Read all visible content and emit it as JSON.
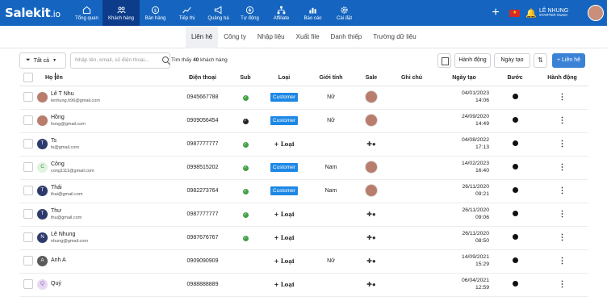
{
  "brand": {
    "logo_main": "Salekit",
    "logo_suffix": ".io"
  },
  "nav": [
    {
      "label": "Tổng quan",
      "icon": "home-icon"
    },
    {
      "label": "Khách hàng",
      "icon": "users-icon",
      "active": true
    },
    {
      "label": "Bán hàng",
      "icon": "dollar-icon"
    },
    {
      "label": "Tiếp thị",
      "icon": "chart-icon"
    },
    {
      "label": "Quảng bá",
      "icon": "megaphone-icon"
    },
    {
      "label": "Tự động",
      "icon": "bolt-icon"
    },
    {
      "label": "Affiliate",
      "icon": "network-icon"
    },
    {
      "label": "Báo cáo",
      "icon": "bar-chart-icon"
    },
    {
      "label": "Cài đặt",
      "icon": "gear-icon"
    }
  ],
  "user": {
    "name": "LÊ NHUNG",
    "plan": "STARTER",
    "role": "Owner"
  },
  "tabs": [
    "Liên hệ",
    "Công ty",
    "Nhập liệu",
    "Xuất file",
    "Danh thiếp",
    "Trường dữ liệu"
  ],
  "toolbar": {
    "filter_label": "Tất cả",
    "search_placeholder": "Nhập tên, email, số điện thoại...",
    "found_prefix": "Tìm thấy",
    "found_count": "40",
    "found_suffix": "khách hàng",
    "action_label": "Hành động",
    "date_label": "Ngày tạo",
    "add_label": "+ Liên hệ"
  },
  "table": {
    "headers": [
      "Họ tên",
      "Điện thoại",
      "Sub",
      "Loại",
      "Giới tính",
      "Sale",
      "Ghi chú",
      "Ngày tạo",
      "Bước",
      "Hành động"
    ],
    "rows": [
      {
        "avatar": "L",
        "avatar_style": "photo",
        "name": "Lê T Nhu",
        "email": "lenhung.h96@gmail.com",
        "phone": "0945667788",
        "sub": "green",
        "type": "Customer",
        "gender": "Nữ",
        "sale": "photo",
        "date": "04/01/2023",
        "time": "14:06"
      },
      {
        "avatar": "H",
        "avatar_style": "photo",
        "name": "Hồng",
        "email": "hong@gmail.com",
        "phone": "0909056454",
        "sub": "dark",
        "type": "Customer",
        "gender": "Nữ",
        "sale": "photo",
        "date": "24/09/2020",
        "time": "14:49"
      },
      {
        "avatar": "T",
        "avatar_style": "navy",
        "name": "Ts",
        "email": "ts@gmail.com",
        "phone": "0987777777",
        "sub": "green",
        "type": "+ Loại",
        "gender": "",
        "sale": "add",
        "date": "04/08/2022",
        "time": "17:13"
      },
      {
        "avatar": "C",
        "avatar_style": "green",
        "name": "Công",
        "email": "cong1111@gmail.com",
        "phone": "0998515202",
        "sub": "green",
        "type": "Customer",
        "gender": "Nam",
        "sale": "photo",
        "date": "14/02/2023",
        "time": "16:40"
      },
      {
        "avatar": "T",
        "avatar_style": "navy",
        "name": "Thái",
        "email": "thai@gmail.com",
        "phone": "0982273764",
        "sub": "green",
        "type": "Customer",
        "gender": "Nam",
        "sale": "photo",
        "date": "26/11/2020",
        "time": "09:21"
      },
      {
        "avatar": "T",
        "avatar_style": "navy",
        "name": "Thư",
        "email": "thu@gmail.com",
        "phone": "0987777777",
        "sub": "green",
        "type": "+ Loại",
        "gender": "",
        "sale": "add",
        "date": "26/11/2020",
        "time": "09:06"
      },
      {
        "avatar": "N",
        "avatar_style": "navy",
        "name": "Lê Nhung",
        "email": "nhung@gmail.com",
        "phone": "0987676767",
        "sub": "green",
        "type": "+ Loại",
        "gender": "",
        "sale": "add",
        "date": "26/11/2020",
        "time": "08:50"
      },
      {
        "avatar": "A",
        "avatar_style": "gray",
        "name": "Anh A",
        "email": "",
        "phone": "0909090909",
        "sub": "",
        "type": "+ Loại",
        "gender": "Nữ",
        "sale": "add",
        "date": "14/09/2021",
        "time": "15:29"
      },
      {
        "avatar": "Q",
        "avatar_style": "lilac",
        "name": "Quý",
        "email": "",
        "phone": "0988888889",
        "sub": "",
        "type": "+ Loại",
        "gender": "",
        "sale": "add",
        "date": "06/04/2021",
        "time": "12:59"
      }
    ]
  },
  "colors": {
    "primary": "#1565c0",
    "active_nav": "#0d3c8a",
    "badge": "#1e88e5",
    "success": "#43a047"
  }
}
